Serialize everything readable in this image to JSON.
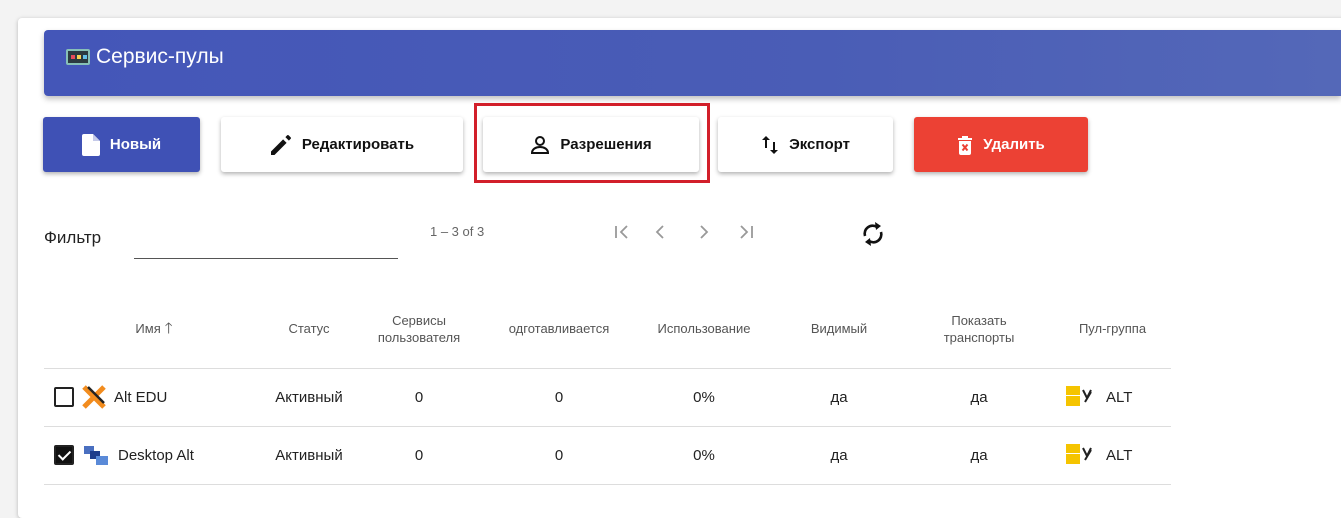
{
  "header": {
    "title": "Сервис-пулы"
  },
  "toolbar": {
    "new_label": "Новый",
    "edit_label": "Редактировать",
    "permissions_label": "Разрешения",
    "export_label": "Экспорт",
    "delete_label": "Удалить"
  },
  "filter": {
    "label": "Фильтр",
    "value": ""
  },
  "pagination": {
    "range": "1 – 3 of 3"
  },
  "colors": {
    "primary": "#3f51b5",
    "danger": "#ec4134",
    "highlight": "#d21f2a"
  },
  "table": {
    "columns": {
      "name": "Имя",
      "status": "Статус",
      "user_services_1": "Сервисы",
      "user_services_2": "пользователя",
      "preparing": "одготавливается",
      "usage": "Использование",
      "visible": "Видимый",
      "show_transports_1": "Показать",
      "show_transports_2": "транспорты",
      "pool_group": "Пул-группа"
    },
    "rows": [
      {
        "checked": false,
        "icon": "alt-edu-icon",
        "name": "Alt EDU",
        "status": "Активный",
        "user_services": "0",
        "preparing": "0",
        "usage": "0%",
        "visible": "да",
        "show_transports": "да",
        "pool_group": "ALT"
      },
      {
        "checked": true,
        "icon": "desktop-alt-icon",
        "name": "Desktop Alt",
        "status": "Активный",
        "user_services": "0",
        "preparing": "0",
        "usage": "0%",
        "visible": "да",
        "show_transports": "да",
        "pool_group": "ALT"
      }
    ]
  }
}
